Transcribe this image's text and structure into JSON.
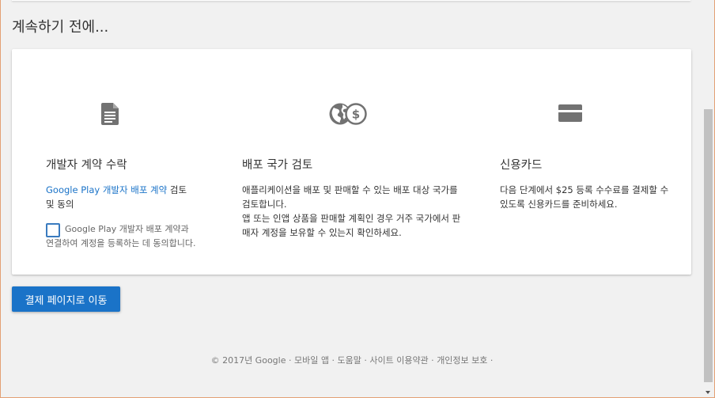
{
  "page": {
    "title": "계속하기 전에..."
  },
  "sections": [
    {
      "icon": "document-icon",
      "title": "개발자 계약 수락",
      "link_text": "Google Play 개발자 배포 계약",
      "text_after_link": " 검토",
      "text_line2": "및 동의",
      "checkbox_label": "Google Play 개발자 배포 계약과 연결하여 계정을 등록하는 데 동의합니다.",
      "checkbox_checked": false
    },
    {
      "icon": "globe-dollar-icon",
      "title": "배포 국가 검토",
      "text_line1": "애플리케이션을 배포 및 판매할 수 있는 배포 대상 국가를 검토합니다.",
      "text_line2": "앱 또는 인앱 상품을 판매할 계획인 경우 거주 국가에서 판매자 계정을 보유할 수 있는지 확인하세요."
    },
    {
      "icon": "credit-card-icon",
      "title": "신용카드",
      "text": "다음 단계에서 $25 등록 수수료를 결제할 수 있도록 신용카드를 준비하세요."
    }
  ],
  "primary_button": {
    "label": "결제 페이지로 이동"
  },
  "footer": {
    "items": [
      "© 2017년 Google",
      "모바일 앱",
      "도움말",
      "사이트 이용약관",
      "개인정보 보호"
    ],
    "separator": " · "
  },
  "colors": {
    "link": "#1a73c8",
    "button": "#1a73c8",
    "background": "#f1f1f1"
  }
}
